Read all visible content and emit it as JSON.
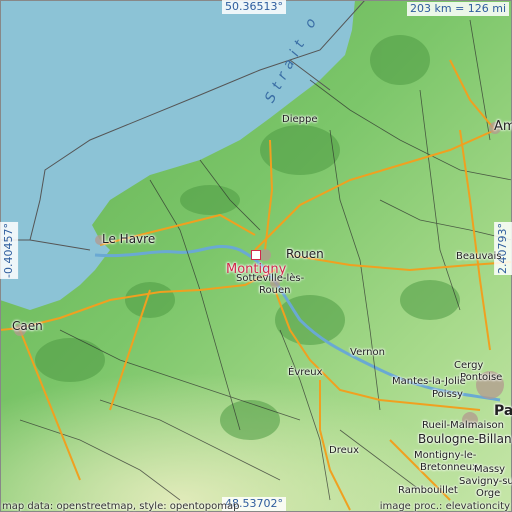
{
  "map": {
    "coords": {
      "top": "50.36513°",
      "bottom": "48.53702°",
      "left": "-0.40457°",
      "right": "2.40793°"
    },
    "scale": "203 km = 126 mi",
    "water_label": "Strait o",
    "highlight": {
      "name": "Montigny",
      "color": "#d0284a"
    },
    "places": [
      {
        "name": "Dieppe"
      },
      {
        "name": "Am"
      },
      {
        "name": "Le Havre"
      },
      {
        "name": "Rouen"
      },
      {
        "name": "Sotteville-lès-"
      },
      {
        "name": "Rouen"
      },
      {
        "name": "Beauvais"
      },
      {
        "name": "Caen"
      },
      {
        "name": "Vernon"
      },
      {
        "name": "Évreux"
      },
      {
        "name": "Cergy"
      },
      {
        "name": "Pontoise"
      },
      {
        "name": "Mantes-la-Jolie"
      },
      {
        "name": "Poissy"
      },
      {
        "name": "Rueil-Malmaison"
      },
      {
        "name": "Boulogne-Billan"
      },
      {
        "name": "Montigny-le-"
      },
      {
        "name": "Bretonneux"
      },
      {
        "name": "Massy"
      },
      {
        "name": "Savigny-sur-"
      },
      {
        "name": "Orge"
      },
      {
        "name": "Dreux"
      },
      {
        "name": "Rambouillet"
      },
      {
        "name": "Pa"
      }
    ],
    "footer_left": "map data: openstreetmap, style: opentopomap",
    "footer_right": "image proc.: elevationcity",
    "colors": {
      "sea": "#8cc3d6",
      "land": "#7cc26a",
      "road": "#f0a020"
    }
  }
}
